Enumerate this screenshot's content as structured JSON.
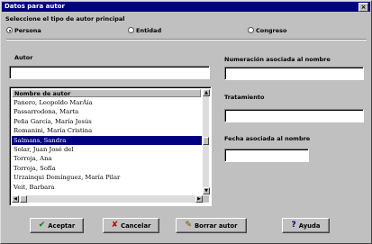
{
  "window": {
    "title": "Datos para autor",
    "close_glyph": "×"
  },
  "tipo_autor": {
    "label": "Seleccione el tipo de autor principal",
    "options": [
      {
        "label": "Persona",
        "selected": true
      },
      {
        "label": "Entidad",
        "selected": false
      },
      {
        "label": "Congreso",
        "selected": false
      }
    ]
  },
  "autor": {
    "label": "Autor",
    "value": ""
  },
  "list": {
    "header": "Nombre de autor",
    "rows": [
      {
        "text": "Panero, Leopoldo MarÁía",
        "selected": false
      },
      {
        "text": "Passarrodona, Marta",
        "selected": false
      },
      {
        "text": "Peña García, María Jesús",
        "selected": false
      },
      {
        "text": "Romanini, María Cristina",
        "selected": false
      },
      {
        "text": "Salmans, Sandra",
        "selected": true
      },
      {
        "text": "Solar, Juan José del",
        "selected": false
      },
      {
        "text": "Torroja, Ana",
        "selected": false
      },
      {
        "text": "Torroja, Sofía",
        "selected": false
      },
      {
        "text": "Urzainqui Domínguez, María Pilar",
        "selected": false
      },
      {
        "text": "Veit, Barbara",
        "selected": false
      }
    ]
  },
  "numeracion": {
    "label": "Numeración asociada al nombre",
    "value": ""
  },
  "tratamiento": {
    "label": "Tratamiento",
    "value": ""
  },
  "fecha": {
    "label": "Fecha asociada al nombre",
    "value": ""
  },
  "buttons": {
    "aceptar": {
      "label": "Aceptar",
      "icon": "check-icon",
      "color": "#008000"
    },
    "cancelar": {
      "label": "Cancelar",
      "icon": "x-icon",
      "color": "#c00000"
    },
    "borrar": {
      "label": "Borrar autor",
      "icon": "eraser-icon"
    },
    "ayuda": {
      "label": "Ayuda",
      "icon": "help-icon",
      "color": "#000080"
    }
  }
}
